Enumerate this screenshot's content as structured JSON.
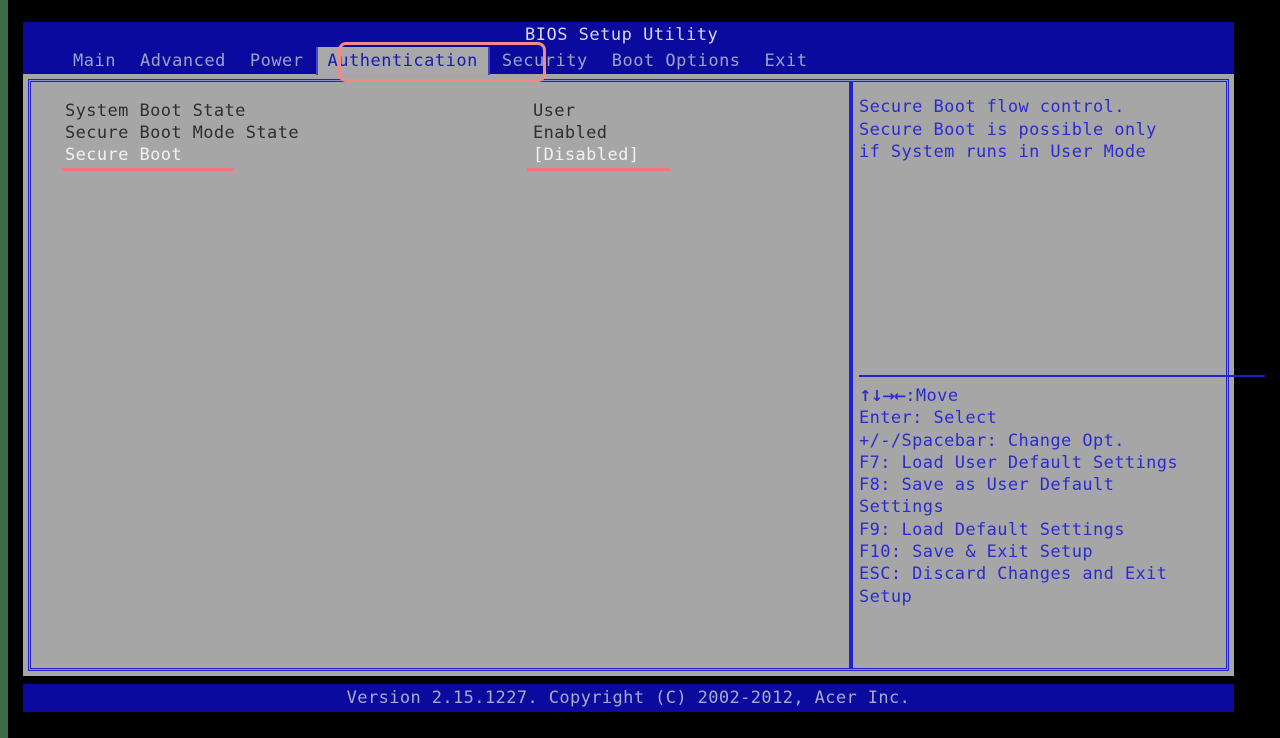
{
  "window": {
    "title": "BIOS Setup Utility",
    "accent_blue": "#0a0a9e",
    "panel_gray": "#a6a6a6",
    "text_blue": "#2b2bd0",
    "annotation_red": "#f2747c"
  },
  "menubar": {
    "items": [
      {
        "label": "Main",
        "active": false
      },
      {
        "label": "Advanced",
        "active": false
      },
      {
        "label": "Power",
        "active": false
      },
      {
        "label": "Authentication",
        "active": true
      },
      {
        "label": "Security",
        "active": false
      },
      {
        "label": "Boot Options",
        "active": false
      },
      {
        "label": "Exit",
        "active": false
      }
    ]
  },
  "settings": {
    "rows": [
      {
        "label": "System Boot State",
        "value": "User",
        "selected": false
      },
      {
        "label": "Secure Boot Mode State",
        "value": "Enabled",
        "selected": false
      },
      {
        "label": "Secure Boot",
        "value": "[Disabled]",
        "selected": true
      }
    ]
  },
  "help": {
    "lines": [
      "Secure Boot flow control.",
      "Secure Boot is possible only",
      "if System runs in User Mode"
    ]
  },
  "keys": {
    "lines": [
      {
        "arrows": "↑↓→←",
        "text": ":Move"
      },
      {
        "arrows": "",
        "text": "Enter: Select"
      },
      {
        "arrows": "",
        "text": "+/-/Spacebar: Change Opt."
      },
      {
        "arrows": "",
        "text": "F7: Load User Default Settings"
      },
      {
        "arrows": "",
        "text": "F8: Save as User Default"
      },
      {
        "arrows": "",
        "text": "Settings"
      },
      {
        "arrows": "",
        "text": "F9: Load Default Settings"
      },
      {
        "arrows": "",
        "text": "F10: Save & Exit Setup"
      },
      {
        "arrows": "",
        "text": "ESC: Discard Changes and Exit"
      },
      {
        "arrows": "",
        "text": "Setup"
      }
    ]
  },
  "footer": {
    "text": "Version 2.15.1227. Copyright (C) 2002-2012, Acer Inc."
  }
}
